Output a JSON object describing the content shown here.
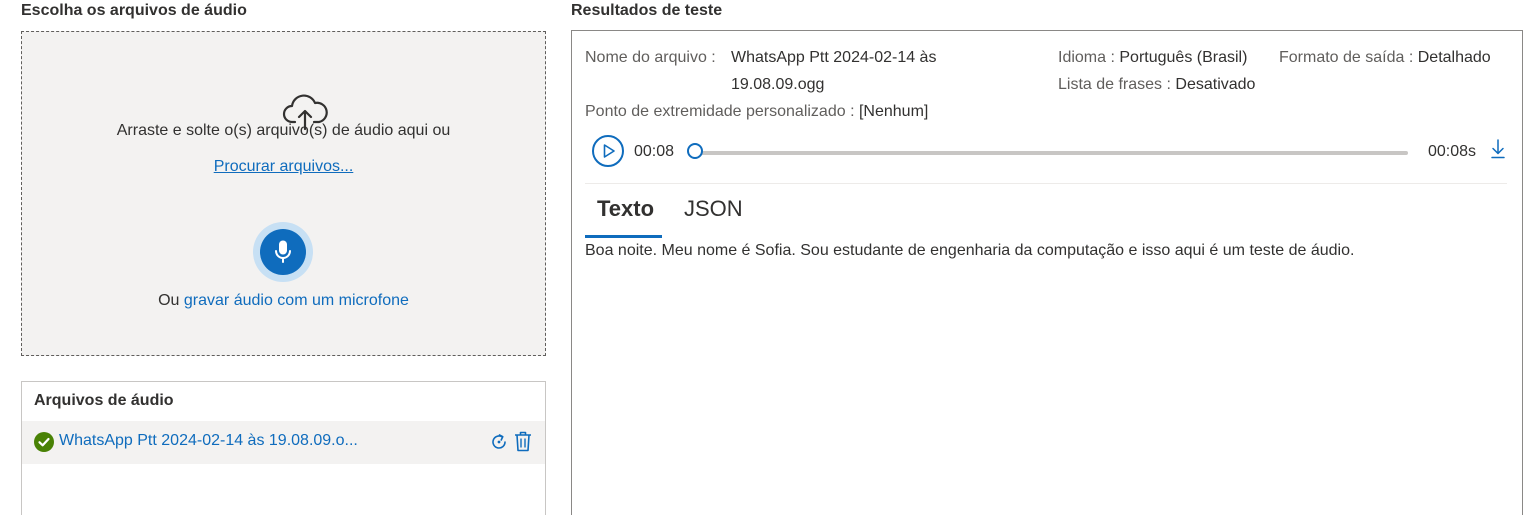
{
  "left": {
    "title": "Escolha os arquivos de áudio",
    "dropzone": {
      "upload_icon": "cloud-upload-icon",
      "drop_text": "Arraste e solte o(s) arquivo(s) de áudio aqui ou",
      "browse_link": "Procurar arquivos...",
      "mic_icon": "microphone-icon",
      "record_prefix": "Ou",
      "record_link": "gravar áudio com um microfone"
    },
    "files": {
      "title": "Arquivos de áudio",
      "items": [
        {
          "status_icon": "check-circle-icon",
          "name": "WhatsApp Ptt 2024-02-14 às 19.08.09.o...",
          "actions": [
            "reprocess-icon",
            "delete-icon"
          ]
        }
      ]
    }
  },
  "right": {
    "title": "Resultados de teste",
    "meta": {
      "file_label": "Nome do arquivo :",
      "file_value": "WhatsApp Ptt 2024-02-14 às 19.08.09.ogg",
      "language_label": "Idioma :",
      "language_value": "Português (Brasil)",
      "format_label": "Formato de saída :",
      "format_value": "Detalhado",
      "phrases_label": "Lista de frases :",
      "phrases_value": "Desativado",
      "endpoint_label": "Ponto de extremidade personalizado :",
      "endpoint_value": "[Nenhum]"
    },
    "player": {
      "play_icon": "play-icon",
      "current_time": "00:08",
      "progress": 0.0,
      "total_time": "00:08s",
      "download_icon": "download-icon"
    },
    "tabs": [
      {
        "label": "Texto",
        "selected": true
      },
      {
        "label": "JSON",
        "selected": false
      }
    ],
    "transcript": "Boa noite. Meu nome é Sofia. Sou estudante de engenharia da computação e isso aqui é um teste de áudio."
  },
  "colors": {
    "accent": "#0f6cbd",
    "success": "#498205",
    "panel_bg": "#f3f2f1",
    "text": "#323130"
  }
}
